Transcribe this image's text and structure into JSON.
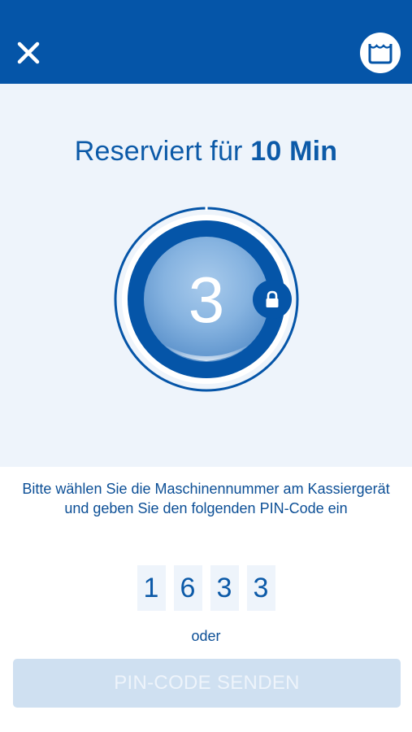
{
  "header": {
    "close_icon": "close-icon",
    "machine_icon": "washing-basin-icon"
  },
  "reservation": {
    "title_prefix": "Reserviert für",
    "title_time": "10 Min",
    "machine_number": "3",
    "lock_icon": "lock-icon",
    "timer_progress": 1.0
  },
  "instructions": "Bitte wählen Sie die Maschinennummer am Kassiergerät und geben Sie den folgenden PIN-Code ein",
  "pin": {
    "digits": [
      "1",
      "6",
      "3",
      "3"
    ]
  },
  "or_label": "oder",
  "send_button": {
    "label": "PIN-CODE SENDEN",
    "enabled": false
  },
  "colors": {
    "brand_blue": "#0555a8",
    "panel_bg": "#eef4fb",
    "text_blue": "#0c5aa8",
    "button_disabled": "#cfe0f1"
  }
}
